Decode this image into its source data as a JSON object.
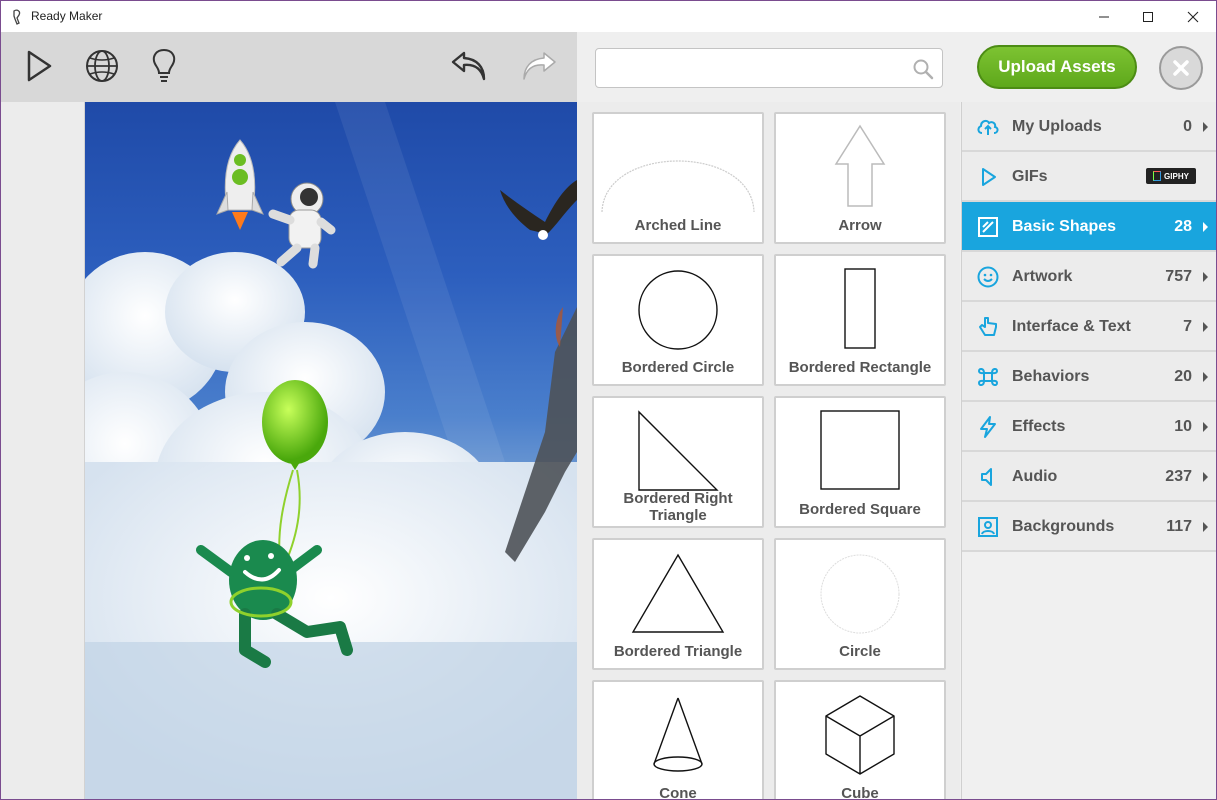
{
  "window": {
    "title": "Ready Maker"
  },
  "toolbar": {
    "play": "play-icon",
    "globe": "globe-icon",
    "hint": "lightbulb-icon",
    "undo": "undo-icon",
    "redo": "redo-icon"
  },
  "search": {
    "value": "",
    "placeholder": ""
  },
  "upload_button": "Upload Assets",
  "shapes": [
    {
      "label": "Arched Line",
      "icon": "arched-line"
    },
    {
      "label": "Arrow",
      "icon": "arrow"
    },
    {
      "label": "Bordered Circle",
      "icon": "bordered-circle"
    },
    {
      "label": "Bordered Rectangle",
      "icon": "bordered-rectangle"
    },
    {
      "label": "Bordered Right Triangle",
      "icon": "bordered-right-triangle"
    },
    {
      "label": "Bordered Square",
      "icon": "bordered-square"
    },
    {
      "label": "Bordered Triangle",
      "icon": "bordered-triangle"
    },
    {
      "label": "Circle",
      "icon": "circle"
    },
    {
      "label": "Cone",
      "icon": "cone"
    },
    {
      "label": "Cube",
      "icon": "cube"
    }
  ],
  "categories": [
    {
      "label": "My Uploads",
      "count": "0",
      "icon": "cloud-upload-icon"
    },
    {
      "label": "GIFs",
      "count": "",
      "icon": "play-triangle-icon",
      "badge": "GIPHY"
    },
    {
      "label": "Basic Shapes",
      "count": "28",
      "icon": "shapes-icon",
      "active": true
    },
    {
      "label": "Artwork",
      "count": "757",
      "icon": "smiley-icon"
    },
    {
      "label": "Interface & Text",
      "count": "7",
      "icon": "hand-pointer-icon"
    },
    {
      "label": "Behaviors",
      "count": "20",
      "icon": "command-icon"
    },
    {
      "label": "Effects",
      "count": "10",
      "icon": "lightning-icon"
    },
    {
      "label": "Audio",
      "count": "237",
      "icon": "speaker-icon"
    },
    {
      "label": "Backgrounds",
      "count": "117",
      "icon": "picture-icon"
    }
  ],
  "colors": {
    "accent": "#19a5de",
    "upload_green": "#6ab526",
    "frame": "#7a4c8f"
  }
}
